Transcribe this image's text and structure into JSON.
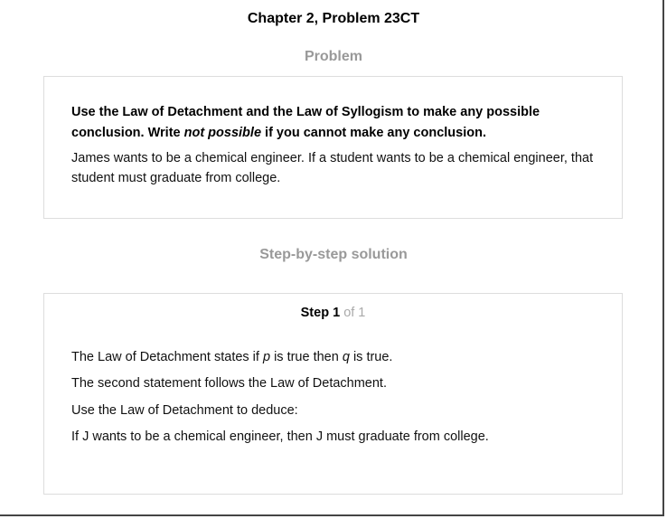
{
  "header": {
    "title": "Chapter 2, Problem 23CT"
  },
  "problem": {
    "heading": "Problem",
    "instruction_part1": "Use the Law of Detachment and the Law of Syllogism to make any possible conclusion. Write ",
    "instruction_emphasis": "not possible",
    "instruction_part2": " if you cannot make any conclusion.",
    "text": "James wants to be a chemical engineer. If a student wants to be a chemical engineer, that student must graduate from college."
  },
  "solution": {
    "heading": "Step-by-step solution",
    "step_word": "Step",
    "step_number": "1",
    "step_of": "of 1",
    "line1_part1": "The Law of Detachment states if ",
    "line1_var_p": "p",
    "line1_part2": " is true then ",
    "line1_var_q": "q",
    "line1_part3": " is true.",
    "line2": "The second statement follows the Law of Detachment.",
    "line3": "Use the Law of Detachment to deduce:",
    "line4": "If J wants to be a chemical engineer, then J must graduate from college."
  }
}
